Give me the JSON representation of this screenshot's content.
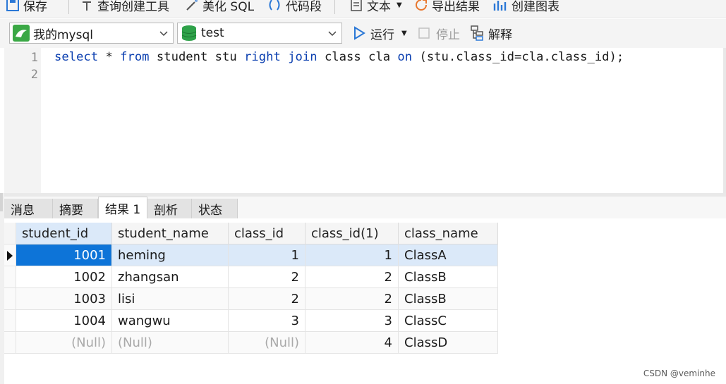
{
  "toolbar_top": {
    "save": "保存",
    "query_builder": "查询创建工具",
    "beautify_sql": "美化 SQL",
    "code_snippet": "代码段",
    "text": "文本",
    "export_results": "导出结果",
    "create_chart": "创建图表"
  },
  "toolbar": {
    "connection": "我的mysql",
    "database": "test",
    "run": "运行",
    "stop": "停止",
    "explain": "解释"
  },
  "editor": {
    "line_numbers": [
      "1",
      "2"
    ],
    "sql": {
      "t1": "select",
      "t2": " * ",
      "t3": "from",
      "t4": " student stu ",
      "t5": "right",
      "t6": " ",
      "t7": "join",
      "t8": " class cla ",
      "t9": "on",
      "t10": " (stu.class_id=cla.class_id);"
    }
  },
  "tabs": [
    "消息",
    "摘要",
    "结果 1",
    "剖析",
    "状态"
  ],
  "results": {
    "columns": [
      "student_id",
      "student_name",
      "class_id",
      "class_id(1)",
      "class_name"
    ],
    "rows": [
      [
        "1001",
        "heming",
        "1",
        "1",
        "ClassA"
      ],
      [
        "1002",
        "zhangsan",
        "2",
        "2",
        "ClassB"
      ],
      [
        "1003",
        "lisi",
        "2",
        "2",
        "ClassB"
      ],
      [
        "1004",
        "wangwu",
        "3",
        "3",
        "ClassC"
      ],
      [
        "(Null)",
        "(Null)",
        "(Null)",
        "4",
        "ClassD"
      ]
    ]
  },
  "watermark": "CSDN @veminhe",
  "colors": {
    "keyword": "#0b3fb0",
    "selection": "#0d74d8",
    "row_highlight": "#dbe9f9"
  }
}
